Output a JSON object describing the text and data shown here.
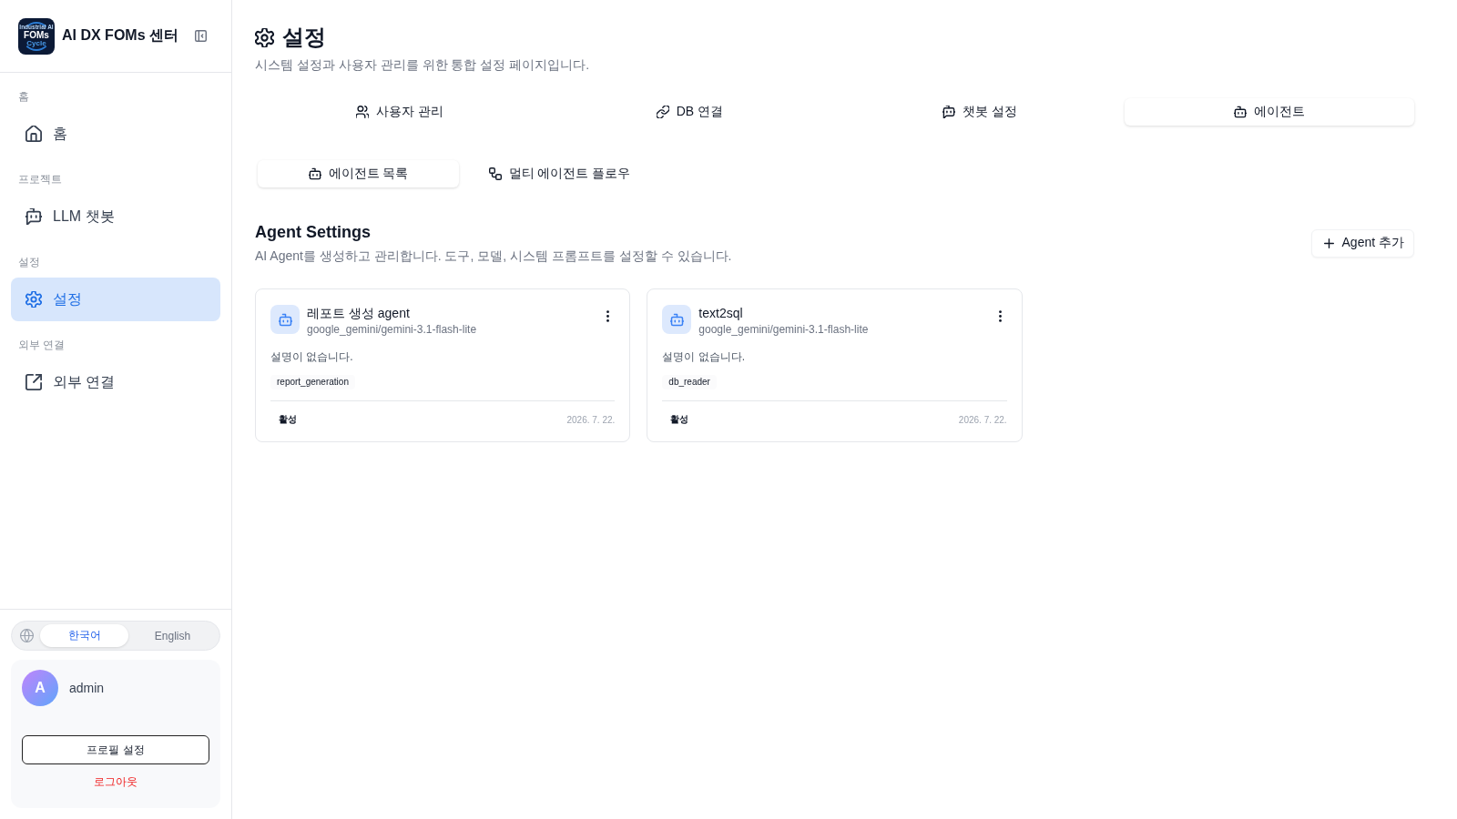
{
  "sidebar": {
    "logo": {
      "lines": [
        "Industrial AI",
        "FOMs",
        "Cycle"
      ]
    },
    "title": "AI DX FOMs 센터",
    "nav_sections": [
      {
        "heading": "홈",
        "items": [
          {
            "label": "홈",
            "kind": "home",
            "selected": false
          }
        ]
      },
      {
        "heading": "프로젝트",
        "items": [
          {
            "label": "LLM 챗봇",
            "kind": "chatbot",
            "selected": false
          }
        ]
      },
      {
        "heading": "설정",
        "items": [
          {
            "label": "설정",
            "kind": "settings",
            "selected": true
          }
        ]
      },
      {
        "heading": "외부 연결",
        "items": [
          {
            "label": "외부 연결",
            "kind": "external",
            "selected": false
          }
        ]
      }
    ],
    "language": [
      {
        "label": "한국어",
        "selected": true
      },
      {
        "label": "English",
        "selected": false
      }
    ],
    "user": {
      "initial": "A",
      "name": "admin"
    },
    "profile_button": "프로필 설정",
    "logout": "로그아웃"
  },
  "page": {
    "title": "설정",
    "subtitle": "시스템 설정과 사용자 관리를 위한 통합 설정 페이지입니다."
  },
  "tabs": [
    {
      "label": "사용자 관리",
      "kind": "users",
      "selected": false
    },
    {
      "label": "DB 연결",
      "kind": "link",
      "selected": false
    },
    {
      "label": "챗봇 설정",
      "kind": "chatbot",
      "selected": false
    },
    {
      "label": "에이전트",
      "kind": "agent",
      "selected": true
    }
  ],
  "subtabs": [
    {
      "label": "에이전트 목록",
      "kind": "agent",
      "selected": true
    },
    {
      "label": "멀티 에이전트 플로우",
      "kind": "flow",
      "selected": false
    }
  ],
  "agent_settings": {
    "title": "Agent Settings",
    "description": "AI Agent를 생성하고 관리합니다. 도구, 모델, 시스템 프롬프트를 설정할 수 있습니다.",
    "add_button": "Agent 추가",
    "agents": [
      {
        "name": "레포트 생성 agent",
        "model": "google_gemini/gemini-3.1-flash-lite",
        "description": "설명이 없습니다.",
        "tools": [
          "report_generation"
        ],
        "status": "활성",
        "date": "2026. 7. 22."
      },
      {
        "name": "text2sql",
        "model": "google_gemini/gemini-3.1-flash-lite",
        "description": "설명이 없습니다.",
        "tools": [
          "db_reader"
        ],
        "status": "활성",
        "date": "2026. 7. 22."
      }
    ]
  }
}
